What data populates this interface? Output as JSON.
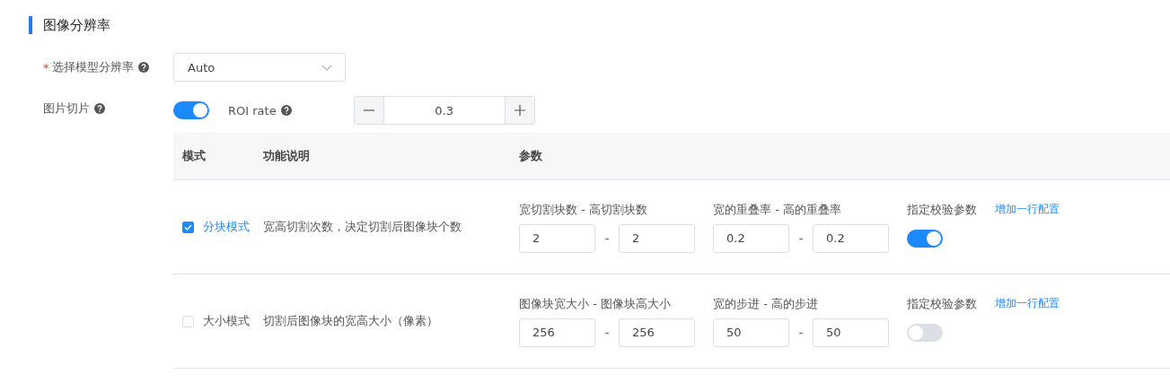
{
  "section": {
    "title": "图像分辨率"
  },
  "resolution": {
    "required_mark": "*",
    "label": "选择模型分辨率",
    "value": "Auto"
  },
  "slicing": {
    "label": "图片切片",
    "on": true,
    "roi": {
      "label": "ROI rate",
      "value": "0.3"
    }
  },
  "table": {
    "columns": [
      "模式",
      "功能说明",
      "参数"
    ],
    "rows": [
      {
        "mode": "分块模式",
        "checked": true,
        "description": "宽高切割次数，决定切割后图像块个数",
        "params": [
          {
            "label": "宽切割块数 - 高切割块数",
            "values": [
              "2",
              "2"
            ],
            "separator": "-"
          },
          {
            "label": "宽的重叠率 - 高的重叠率",
            "values": [
              "0.2",
              "0.2"
            ],
            "separator": "-"
          }
        ],
        "verify": {
          "label": "指定校验参数",
          "on": true
        },
        "link": "增加一行配置"
      },
      {
        "mode": "大小模式",
        "checked": false,
        "description": "切割后图像块的宽高大小（像素）",
        "params": [
          {
            "label": "图像块宽大小 - 图像块高大小",
            "values": [
              "256",
              "256"
            ],
            "separator": "-"
          },
          {
            "label": "宽的步进 - 高的步进",
            "values": [
              "50",
              "50"
            ],
            "separator": "-"
          }
        ],
        "verify": {
          "label": "指定校验参数",
          "on": false
        },
        "link": "增加一行配置"
      }
    ]
  }
}
